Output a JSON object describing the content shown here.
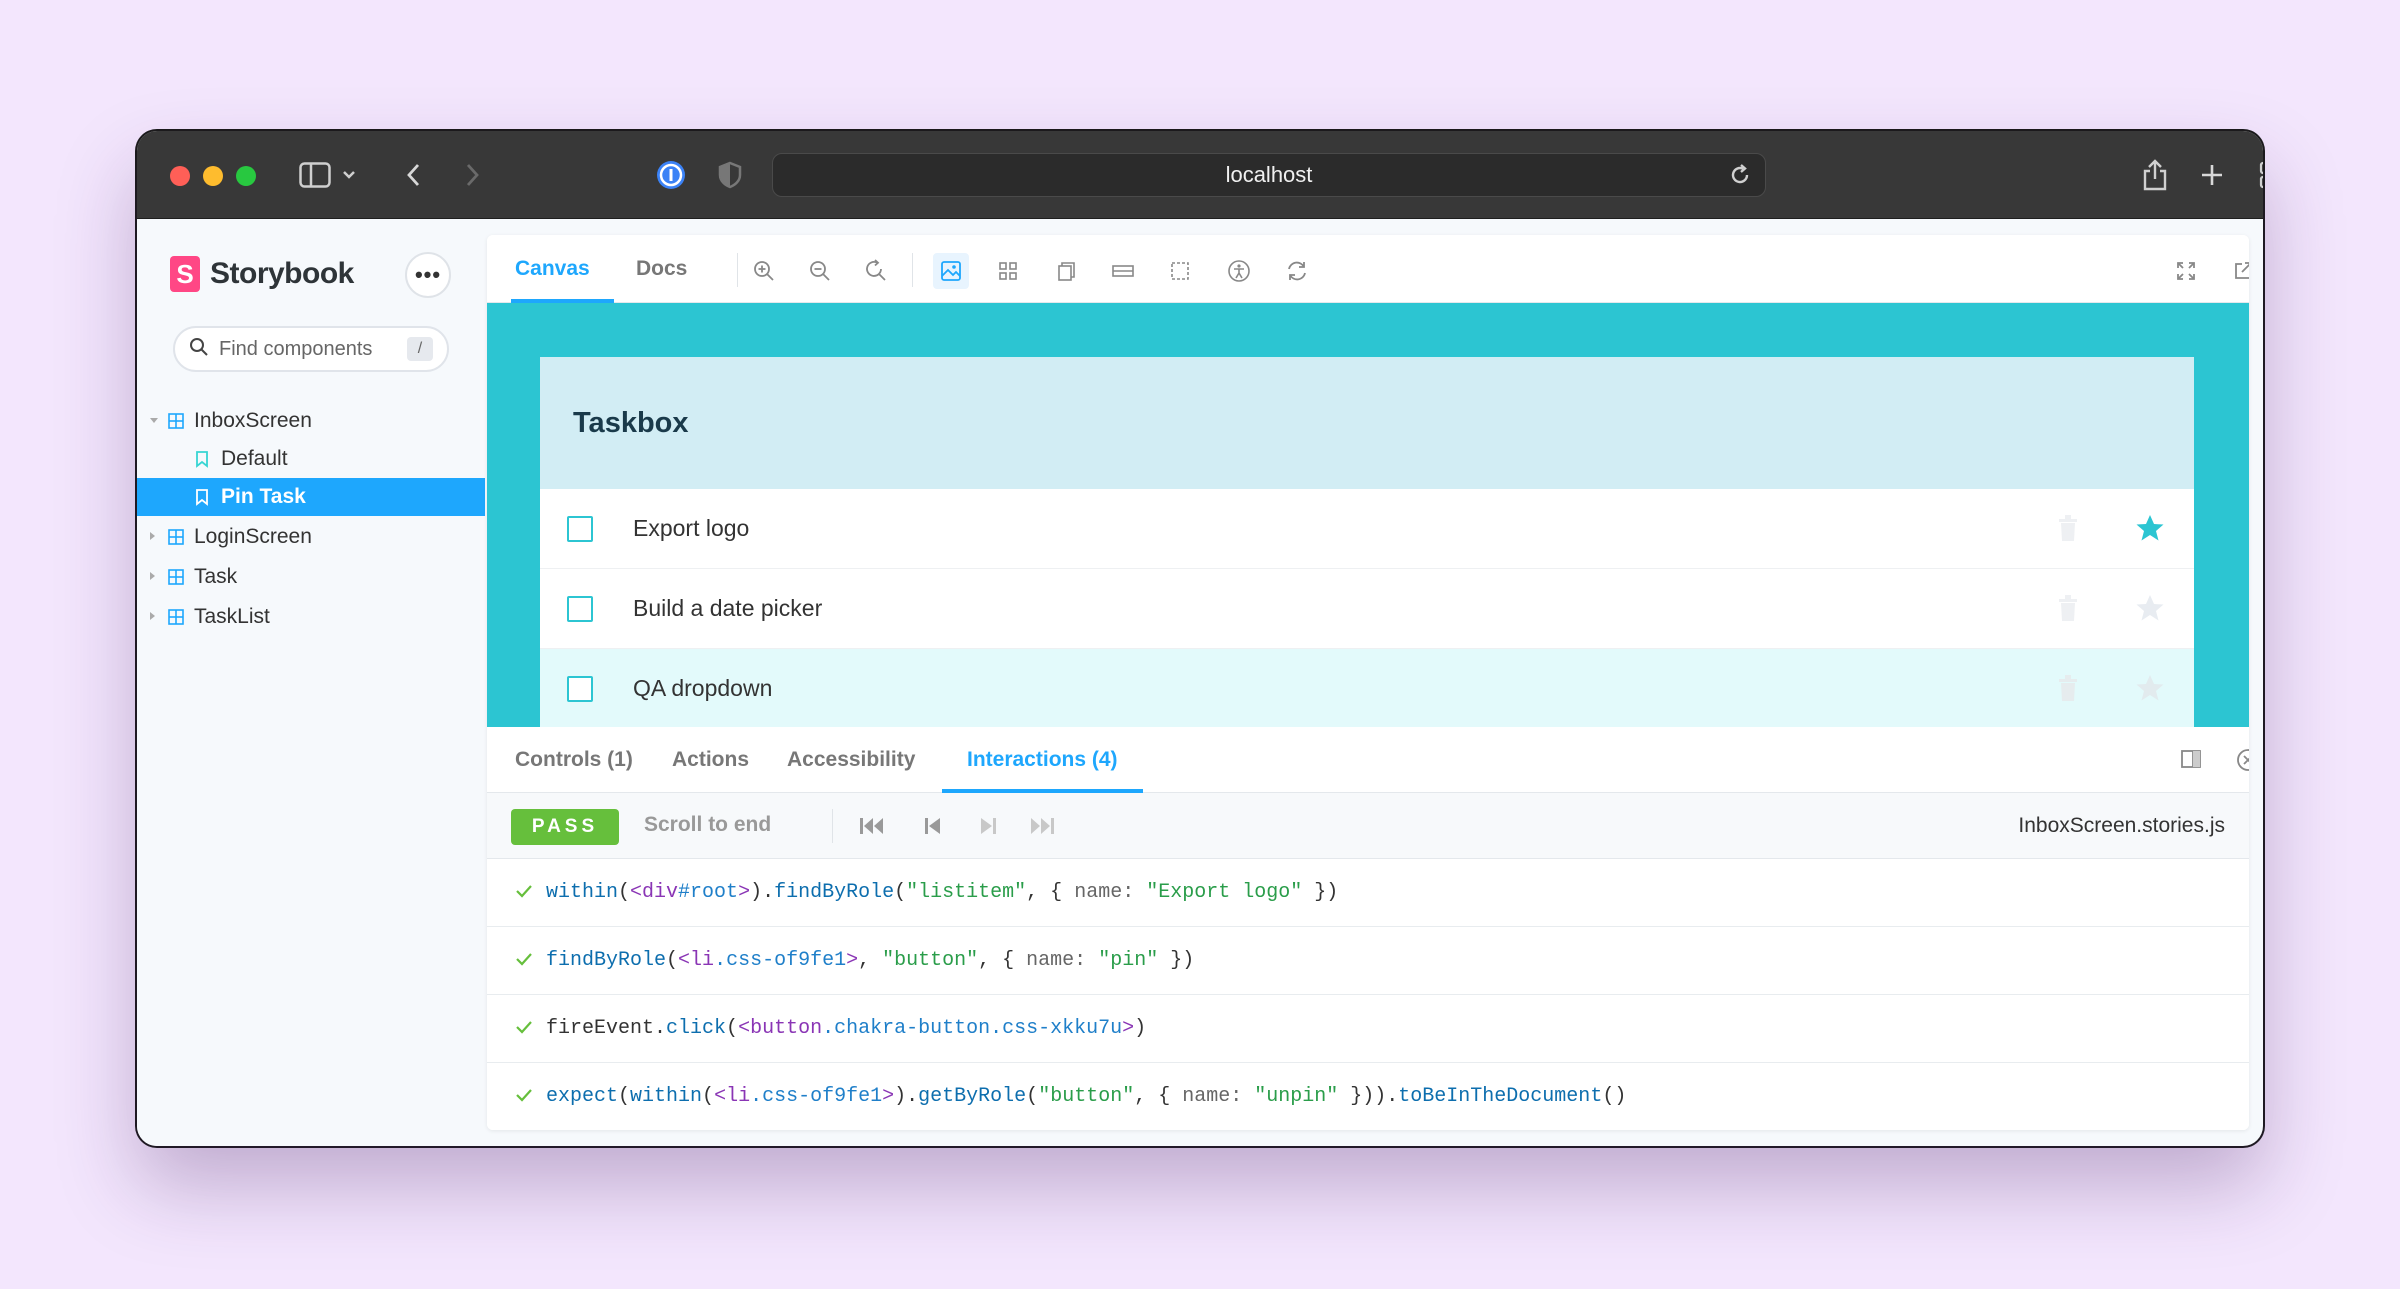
{
  "browser": {
    "url": "localhost"
  },
  "sidebar": {
    "brand": "Storybook",
    "menu_label": "•••",
    "search_placeholder": "Find components",
    "search_shortcut": "/",
    "items": [
      {
        "label": "InboxScreen",
        "type": "component",
        "expanded": true
      },
      {
        "label": "Default",
        "type": "story"
      },
      {
        "label": "Pin Task",
        "type": "story",
        "selected": true
      },
      {
        "label": "LoginScreen",
        "type": "component"
      },
      {
        "label": "Task",
        "type": "component"
      },
      {
        "label": "TaskList",
        "type": "component"
      }
    ]
  },
  "toolbar": {
    "tabs": [
      "Canvas",
      "Docs"
    ],
    "active_tab": "Canvas"
  },
  "canvas": {
    "title": "Taskbox",
    "tasks": [
      {
        "title": "Export logo",
        "pinned": true
      },
      {
        "title": "Build a date picker",
        "pinned": false
      },
      {
        "title": "QA dropdown",
        "pinned": false
      }
    ]
  },
  "addons": {
    "tabs": [
      "Controls (1)",
      "Actions",
      "Accessibility",
      "Interactions (4)"
    ],
    "active_tab": "Interactions (4)",
    "status": "PASS",
    "scroll_label": "Scroll to end",
    "file": "InboxScreen.stories.js"
  },
  "colors": {
    "accent": "#1ea7fd",
    "canvas_bg": "#2cc5d2",
    "pass": "#66bf3c",
    "brand": "#ff4785"
  }
}
